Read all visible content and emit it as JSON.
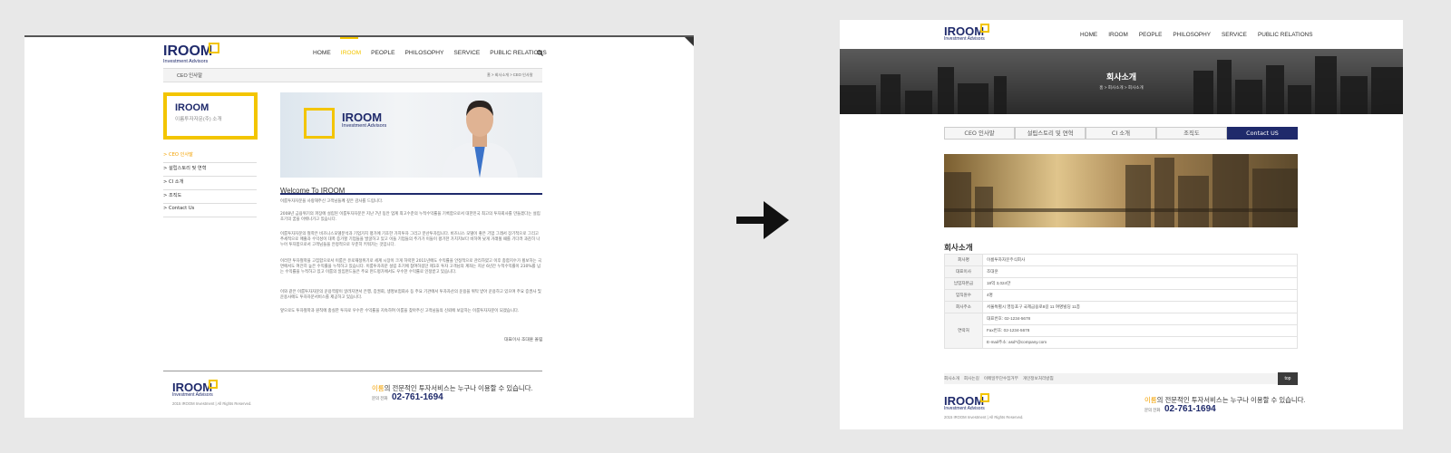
{
  "left": {
    "logo": {
      "word": "IROOM",
      "sub": "Investment Advisors"
    },
    "nav": [
      "HOME",
      "IROOM",
      "PEOPLE",
      "PHILOSOPHY",
      "SERVICE",
      "PUBLIC RELATIONS"
    ],
    "nav_active": "IROOM",
    "search_icon": "search-icon",
    "subheader": {
      "title": "CEO 인사말",
      "crumb": "홈 > 회사소개 > CEO 인사말"
    },
    "sidebox": {
      "title": "IROOM",
      "subtitle": "이룸투자자문(주) 소개"
    },
    "side_menu": [
      "CEO 인사말",
      "설립스토리 및 연혁",
      "CI 소개",
      "조직도",
      "Contact Us"
    ],
    "banner": {
      "word": "IROOM",
      "sub": "Investment Advisors"
    },
    "welcome": "Welcome To IROOM",
    "paragraphs": [
      "이룸투자자문을 사랑해주신 고객님들께 깊은 감사를 드립니다.",
      "2008년 금융위기의 파장에 설립된 이룸투자자문은 지난 7년 동안 업계 최고수준의 누적수익률을 기록함으로서 대한민국 최고의 투자회사를 만들겠다는 설립 초기의 꿈을 이뤄나가고 있습니다.",
      "이룸투자자문의 철학은 비즈니스모델분석과 기업가치 평가에 기초한 가치투자 그리고 분산투자입니다. 비즈니스 모델이 좋은 기업 그래서 장기적으로 그리고 추세적으로 매출과 수익성이 대폭 증가할 기업들을 발굴하고 있고 이들 기업들의 주가가 이들이 평가한 가치치보다 비하여 낮게 거래될 때를 기다려 과감히 나누어 투자함으로서 고객님들을 안정적으로 꾸준히 키워가는 것입니다.",
      "이러한 투자철학을 고집함으로서 이룸은 유로재정위기로 세계 시장이 크게 하락한 2011년에도 수익률을 안정적으로 관리하였고 이후 종합지수가 횡보하는 국면에서도 여전히 높은 수익률을 누적하고 있습니다. 이룸투자자문 설립 초기에 참여하셨던 제1호 투자 고객님의 계좌는 지난 6년간 누적수익률이 230%를 넘는 수익률을 누적하고 있고 이룸의 일임펀드들은 주요 펀드평가에서도 우수한 수익률로 인정받고 있습니다.",
      "이와 같은 이룸투자자문의 운용역량이 알려지면서 은행, 증권회, 생명보험회사 등 주요 기관에서 투자자산의 운용을 위탁 받아 운용하고 있으며 주요 증권사 및 운용사에도 투자자문서비스를 제공하고 있습니다.",
      "앞으로도 투자철학과 원칙에 충실한 투자로 우수한 수익률을 지속하여 이룸을 찾아주신 고객님들의 신뢰에 보답하는 이룸투자자문이 되겠습니다."
    ],
    "signature": "대표이사 조대훈 올림",
    "footer": {
      "logo_word": "IROOM",
      "logo_sub": "Investment Advisors",
      "copy": "2015 IROOM Investment | All Rights Reserved.",
      "slogan_hl": "이룸",
      "slogan_rest": "의 전문적인 투자서비스는 누구나 이용할 수 있습니다.",
      "phone_label": "문의 전화",
      "phone": "02-761-1694"
    }
  },
  "right": {
    "logo": {
      "word": "IROOM",
      "sub": "Investment Advisors"
    },
    "nav": [
      "HOME",
      "IROOM",
      "PEOPLE",
      "PHILOSOPHY",
      "SERVICE",
      "PUBLIC RELATIONS"
    ],
    "hero": {
      "title": "회사소개",
      "crumb": "홈 > 회사소개 > 회사소개"
    },
    "tabs": [
      "CEO 인사말",
      "설립스토리 및 연혁",
      "CI 소개",
      "조직도",
      "Contact US"
    ],
    "active_tab": "Contact US",
    "section_title": "회사소개",
    "info": [
      {
        "k": "회사명",
        "v": "이룸투자자문주식회사"
      },
      {
        "k": "대표이사",
        "v": "조대훈"
      },
      {
        "k": "납입자본금",
        "v": "18억 3,024만"
      },
      {
        "k": "임직원수",
        "v": "4명"
      },
      {
        "k": "회사주소",
        "v": "서울특별시 영등포구 국제금융로8길 11 여명빌딩 11층"
      }
    ],
    "contact": {
      "k": "연락처",
      "lines": [
        "대표번호: 02-1234-5678",
        "Fax번호: 02-1234-5678",
        "E-mail주소: asd*@company.com"
      ]
    },
    "footer_links": [
      "회사소개",
      "회사는길",
      "이메일무단수집거부",
      "개인정보처리방침"
    ],
    "top_button": "top",
    "footer": {
      "logo_word": "IROOM",
      "logo_sub": "Investment Advisors",
      "copy": "2015 IROOM Investment | All Rights Reserved.",
      "slogan_hl": "이룸",
      "slogan_rest": "의 전문적인 투자서비스는 누구나 이용할 수 있습니다.",
      "phone_label": "문의 전화",
      "phone": "02-761-1694"
    }
  },
  "colors": {
    "navy": "#1f2a6b",
    "accent_yellow": "#f3c500",
    "hero_dark": "#2b2b2b"
  }
}
